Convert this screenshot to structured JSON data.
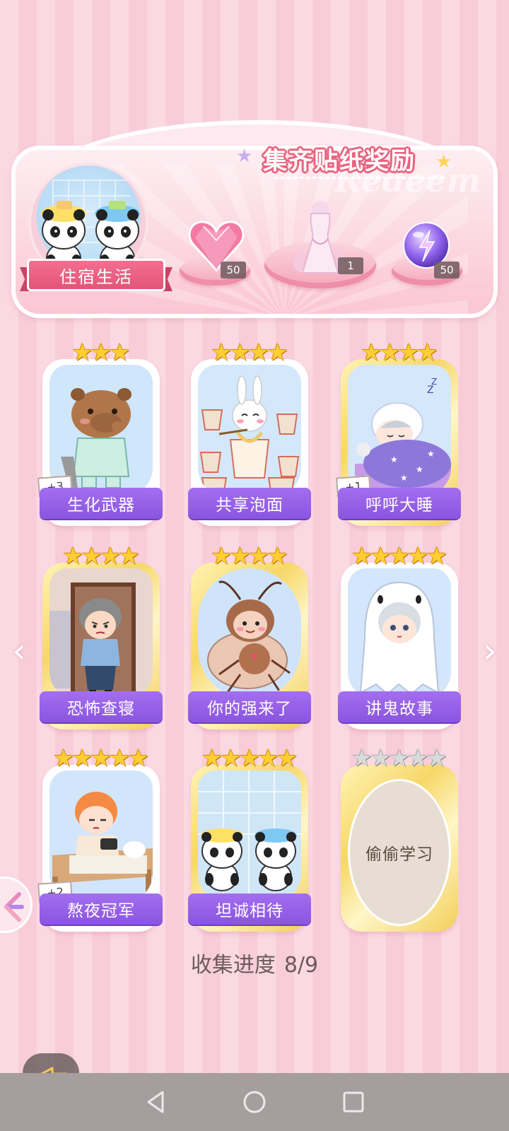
{
  "banner": {
    "title": "集齐贴纸奖励",
    "decor_text": "Redeem",
    "theme_name": "住宿生活",
    "rewards": [
      {
        "icon": "pink-heart-gem-icon",
        "count": "50"
      },
      {
        "icon": "dress-outfit-icon",
        "count": "1"
      },
      {
        "icon": "purple-energy-orb-icon",
        "count": "50"
      }
    ]
  },
  "cards": [
    {
      "name": "生化武器",
      "stars": 3,
      "frame": "white",
      "extra": "+3",
      "art": "capybara"
    },
    {
      "name": "共享泡面",
      "stars": 4,
      "frame": "white",
      "extra": "",
      "art": "bunny-noodles"
    },
    {
      "name": "呼呼大睡",
      "stars": 4,
      "frame": "gold",
      "extra": "+1",
      "art": "sleeping-boy"
    },
    {
      "name": "恐怖查寝",
      "stars": 4,
      "frame": "gold",
      "extra": "",
      "art": "dorm-auntie"
    },
    {
      "name": "你的强来了",
      "stars": 4,
      "frame": "gold",
      "extra": "",
      "art": "cockroach"
    },
    {
      "name": "讲鬼故事",
      "stars": 5,
      "frame": "white",
      "extra": "",
      "art": "ghost-boy"
    },
    {
      "name": "熬夜冠军",
      "stars": 5,
      "frame": "white",
      "extra": "+2",
      "art": "gamer-boy"
    },
    {
      "name": "坦诚相待",
      "stars": 5,
      "frame": "gold",
      "extra": "",
      "art": "pandas-bath"
    },
    {
      "name": "偷偷学习",
      "stars": 5,
      "frame": "gold",
      "extra": "",
      "art": "locked",
      "locked": true
    }
  ],
  "progress": {
    "label": "收集进度",
    "value": "8/9"
  },
  "colors": {
    "label_purple": "#9a62ea",
    "pink_accent": "#e9637f",
    "gold": "#f7d768"
  }
}
